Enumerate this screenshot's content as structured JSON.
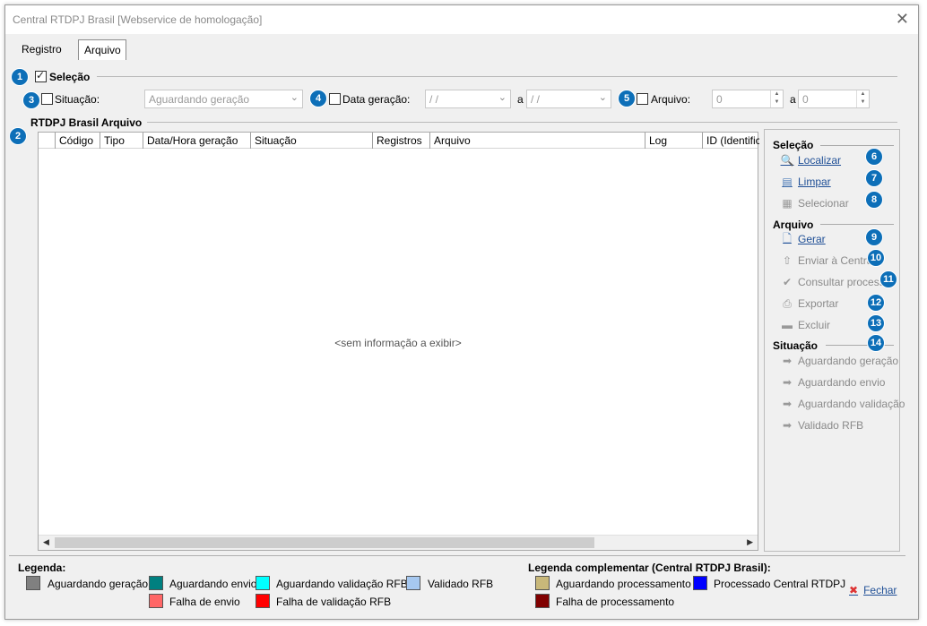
{
  "window": {
    "title": "Central RTDPJ Brasil [Webservice de homologação]"
  },
  "tabs": [
    {
      "label": "Registro"
    },
    {
      "label": "Arquivo"
    }
  ],
  "selecao": {
    "title": "Seleção",
    "situacao_label": "Situação:",
    "situacao_value": "Aguardando geração",
    "data_label": "Data geração:",
    "data_from": "/ /",
    "data_sep": "a",
    "data_to": "/ /",
    "arquivo_label": "Arquivo:",
    "arquivo_from": "0",
    "arquivo_sep": "a",
    "arquivo_to": "0"
  },
  "grid": {
    "title": "RTDPJ Brasil Arquivo",
    "columns": [
      "Código",
      "Tipo",
      "Data/Hora geração",
      "Situação",
      "Registros",
      "Arquivo",
      "Log",
      "ID (Identifica"
    ],
    "empty_message": "<sem informação a exibir>"
  },
  "side": {
    "selecao_header": "Seleção",
    "selecao_actions": [
      "Localizar",
      "Limpar",
      "Selecionar"
    ],
    "arquivo_header": "Arquivo",
    "arquivo_actions": [
      "Gerar",
      "Enviar à Central",
      "Consultar process.",
      "Exportar",
      "Excluir"
    ],
    "situacao_header": "Situação",
    "situacao_actions": [
      "Aguardando geração",
      "Aguardando envio",
      "Aguardando validação",
      "Validado RFB"
    ]
  },
  "badges": [
    "1",
    "2",
    "3",
    "4",
    "5",
    "6",
    "7",
    "8",
    "9",
    "10",
    "11",
    "12",
    "13",
    "14"
  ],
  "legenda": {
    "title": "Legenda:",
    "items": [
      {
        "label": "Aguardando geração",
        "color": "#808080"
      },
      {
        "label": "Aguardando envio",
        "color": "#008080"
      },
      {
        "label": "Aguardando validação RFB",
        "color": "#00ffff"
      },
      {
        "label": "Validado RFB",
        "color": "#a6c8f0"
      },
      {
        "label": "Falha de envio",
        "color": "#ff6666"
      },
      {
        "label": "Falha de validação RFB",
        "color": "#ff0000"
      }
    ]
  },
  "legenda_comp": {
    "title": "Legenda complementar (Central RTDPJ Brasil):",
    "items": [
      {
        "label": "Aguardando processamento",
        "color": "#c8b87a"
      },
      {
        "label": "Processado Central RTDPJ",
        "color": "#0000ff"
      },
      {
        "label": "Falha de processamento",
        "color": "#800000"
      }
    ]
  },
  "footer": {
    "fechar": "Fechar"
  }
}
